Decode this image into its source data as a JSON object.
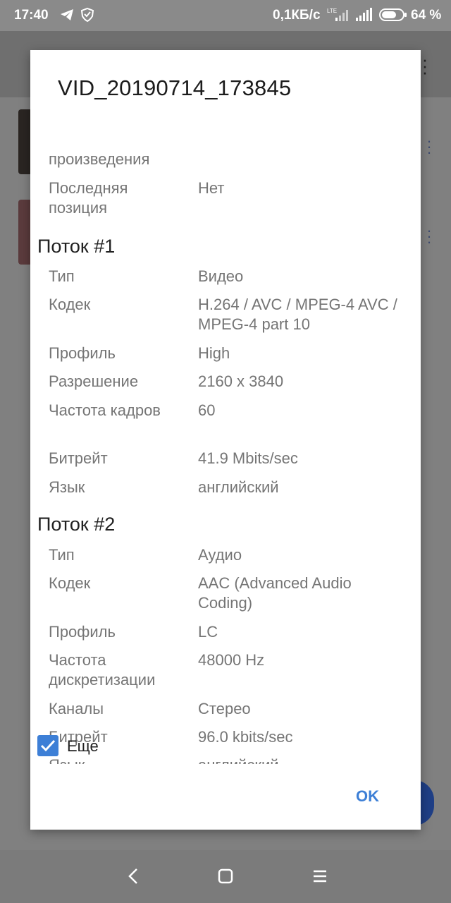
{
  "status_bar": {
    "time": "17:40",
    "network_speed": "0,1КБ/с",
    "battery": "64 %",
    "icons": [
      "telegram-icon",
      "shield-icon",
      "lte-signal-icon",
      "signal-icon",
      "battery-icon"
    ]
  },
  "dialog": {
    "title": "VID_20190714_173845",
    "cut_off_label": "произведения",
    "last_position": {
      "label": "Последняя позиция",
      "value": "Нет"
    },
    "streams": [
      {
        "heading": "Поток #1",
        "rows": [
          {
            "label": "Тип",
            "value": "Видео"
          },
          {
            "label": "Кодек",
            "value": "H.264 / AVC / MPEG-4 AVC / MPEG-4 part 10"
          },
          {
            "label": "Профиль",
            "value": "High"
          },
          {
            "label": "Разрешение",
            "value": "2160 x 3840"
          },
          {
            "label": "Частота кадров",
            "value": "60"
          },
          {
            "label": "Битрейт",
            "value": "41.9 Mbits/sec"
          },
          {
            "label": "Язык",
            "value": "английский"
          }
        ]
      },
      {
        "heading": "Поток #2",
        "rows": [
          {
            "label": "Тип",
            "value": "Аудио"
          },
          {
            "label": "Кодек",
            "value": "AAC (Advanced Audio Coding)"
          },
          {
            "label": "Профиль",
            "value": "LC"
          },
          {
            "label": "Частота дискретизации",
            "value": "48000 Hz"
          },
          {
            "label": "Каналы",
            "value": "Стерео"
          },
          {
            "label": "Битрейт",
            "value": "96.0 kbits/sec"
          },
          {
            "label": "Язык",
            "value": "английский"
          }
        ]
      }
    ],
    "more_checkbox": {
      "label": "Еще",
      "checked": true
    },
    "ok_label": "OK"
  },
  "colors": {
    "accent": "#3d7fd6",
    "scrim": "#7b7b7b"
  }
}
